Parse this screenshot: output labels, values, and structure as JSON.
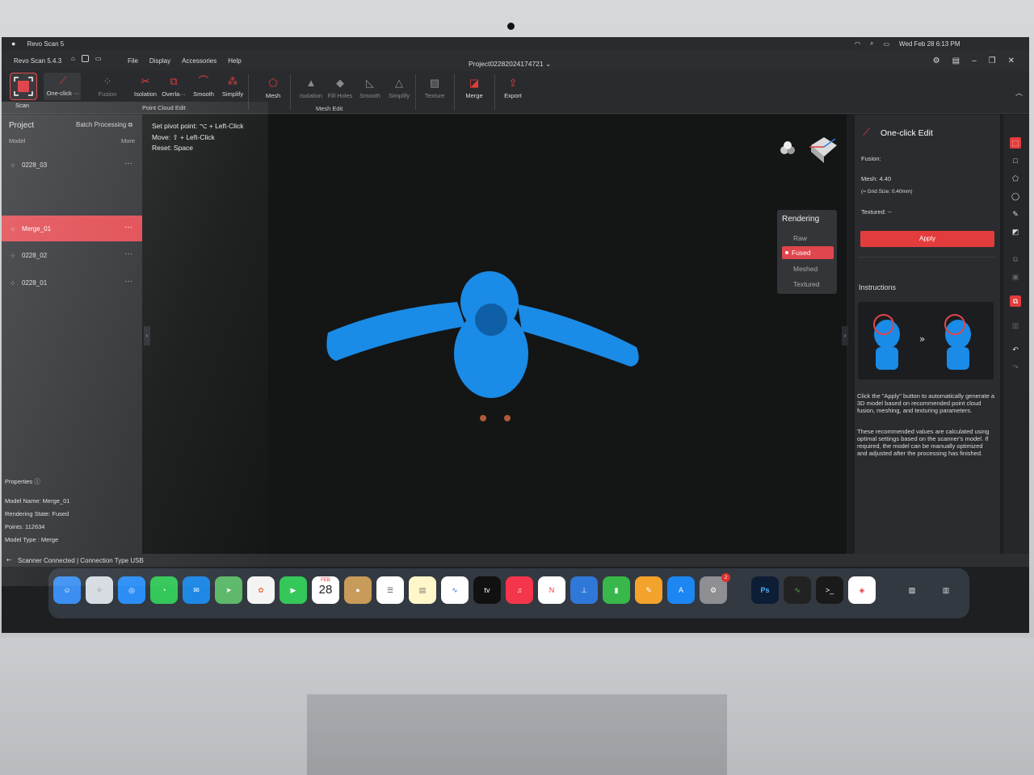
{
  "menubar": {
    "app_name": "Revo Scan 5",
    "datetime": "Wed Feb 28  6:13 PM"
  },
  "titlebar": {
    "version": "Revo Scan 5.4.3",
    "menus": [
      "File",
      "Display",
      "Accessories",
      "Help"
    ],
    "project": "Project02282024174721 ⌄"
  },
  "toolbar": {
    "scan": "Scan",
    "one_click": "One-click ···",
    "fusion": "Fusion",
    "pc_isolation": "Isolation",
    "pc_overlap": "Overla···",
    "pc_smooth": "Smooth",
    "pc_simplify": "Simplify",
    "group_point_cloud": "Point Cloud Edit",
    "mesh": "Mesh",
    "m_isolation": "Isolation",
    "m_fill_holes": "Fill Holes",
    "m_smooth": "Smooth",
    "m_simplify": "Simplify",
    "group_mesh": "Mesh Edit",
    "texture": "Texture",
    "merge": "Merge",
    "export": "Export"
  },
  "project_panel": {
    "title": "Project",
    "batch": "Batch Processing",
    "model_header": "Model",
    "more": "More",
    "models": [
      {
        "name": "0228_03",
        "selected": false
      },
      {
        "name": "Merge_01",
        "selected": true
      },
      {
        "name": "0228_02",
        "selected": false
      },
      {
        "name": "0228_01",
        "selected": false
      }
    ]
  },
  "properties": {
    "title": "Properties",
    "model_name": "Model Name:  Merge_01",
    "rendering_state": "Rendering State:  Fused",
    "points": "Points:  112634",
    "model_type": "Model Type :  Merge"
  },
  "viewport_hints": {
    "pivot": "Set pivot point:  ⌥ + Left-Click",
    "move": "Move:  ⇧ + Left-Click",
    "reset": "Reset:  Space"
  },
  "rendering": {
    "title": "Rendering",
    "raw": "Raw",
    "fused": "Fused",
    "meshed": "Meshed",
    "textured": "Textured",
    "selected": "Fused"
  },
  "one_click_edit": {
    "title": "One-click Edit",
    "fusion": "Fusion:",
    "mesh": "Mesh:  4.40",
    "grid": "(≈ Grid Size: 0.40mm)",
    "textured": "Textured: --",
    "apply": "Apply",
    "instructions": "Instructions",
    "para1": "Click the \"Apply\" button to automatically generate a 3D model based on recommended point cloud fusion, meshing, and texturing parameters.",
    "para2": "These recommended values are calculated using optimal settings based on the scanner's model. If required, the model can be manually optimized and adjusted after the processing has finished."
  },
  "status": {
    "text": "Scanner Connected | Connection Type USB"
  },
  "dock": {
    "calendar_month": "FEB",
    "calendar_day": "28",
    "tv_label": "tv",
    "ps_label": "Ps",
    "settings_badge": "2",
    "colors": {
      "accent": "#e0464d",
      "model": "#1a8be6"
    }
  }
}
